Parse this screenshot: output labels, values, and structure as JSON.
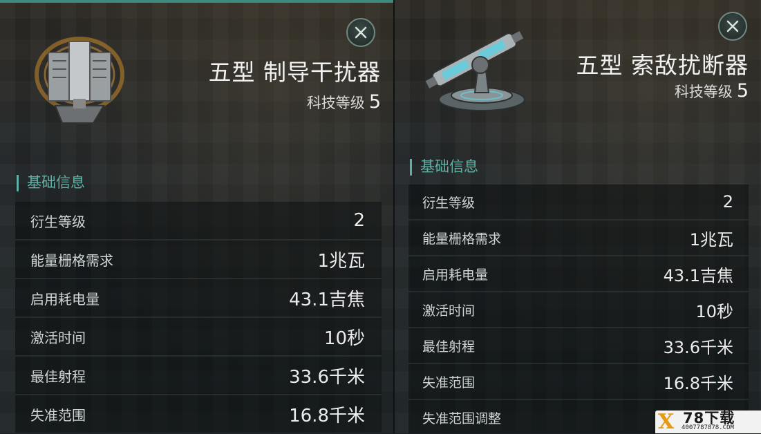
{
  "left_panel": {
    "item_name": "五型 制导干扰器",
    "tech_label": "科技等级",
    "tech_level": "5",
    "section_title": "基础信息",
    "icon": "guidance-disruptor-module-icon",
    "rows": [
      {
        "label": "衍生等级",
        "value": "2"
      },
      {
        "label": "能量栅格需求",
        "value": "1兆瓦"
      },
      {
        "label": "启用耗电量",
        "value": "43.1吉焦"
      },
      {
        "label": "激活时间",
        "value": "10秒"
      },
      {
        "label": "最佳射程",
        "value": "33.6千米"
      },
      {
        "label": "失准范围",
        "value": "16.8千米"
      }
    ]
  },
  "right_panel": {
    "item_name": "五型 索敌扰断器",
    "tech_label": "科技等级",
    "tech_level": "5",
    "section_title": "基础信息",
    "icon": "sensor-dampener-module-icon",
    "rows": [
      {
        "label": "衍生等级",
        "value": "2"
      },
      {
        "label": "能量栅格需求",
        "value": "1兆瓦"
      },
      {
        "label": "启用耗电量",
        "value": "43.1吉焦"
      },
      {
        "label": "激活时间",
        "value": "10秒"
      },
      {
        "label": "最佳射程",
        "value": "33.6千米"
      },
      {
        "label": "失准范围",
        "value": "16.8千米"
      },
      {
        "label": "失准范围调整",
        "value": ""
      }
    ]
  },
  "watermark": {
    "logo_letter": "X",
    "logo_text": "78下载",
    "url": "4007787878.COM"
  },
  "colors": {
    "accent": "#5fb0a5",
    "background": "#1f2527",
    "text": "#ececec"
  }
}
